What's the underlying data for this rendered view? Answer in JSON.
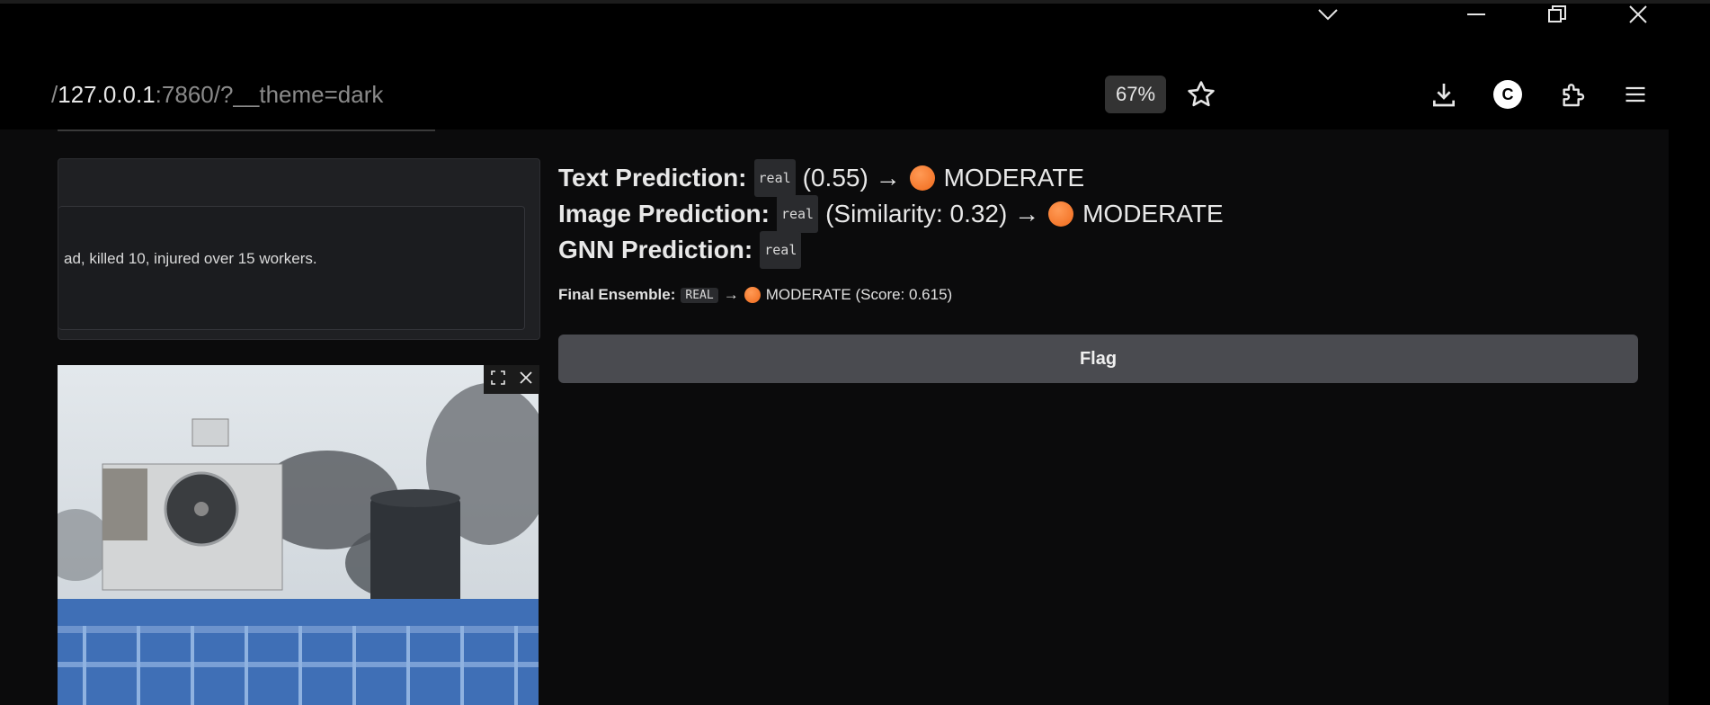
{
  "browser": {
    "url_prefix": "/",
    "url_host": "127.0.0.1",
    "url_rest": ":7860/?__theme=dark",
    "zoom": "67%",
    "profile_initial": "C"
  },
  "input": {
    "text_value": "ad, killed 10, injured over 15 workers."
  },
  "results": {
    "text_prediction_label": "Text Prediction:",
    "text_prediction_tag": "real",
    "text_prediction_score": "(0.55) →",
    "text_prediction_level": "MODERATE",
    "image_prediction_label": "Image Prediction:",
    "image_prediction_tag": "real",
    "image_prediction_score": "(Similarity: 0.32) →",
    "image_prediction_level": "MODERATE",
    "gnn_prediction_label": "GNN Prediction:",
    "gnn_prediction_tag": "real",
    "final_label": "Final Ensemble:",
    "final_tag": "REAL",
    "final_arrow": "→",
    "final_text": "MODERATE (Score: 0.615)"
  },
  "flag_button": "Flag",
  "colors": {
    "moderate_dot": "#f26d1d",
    "button_bg": "#4a4b50"
  }
}
